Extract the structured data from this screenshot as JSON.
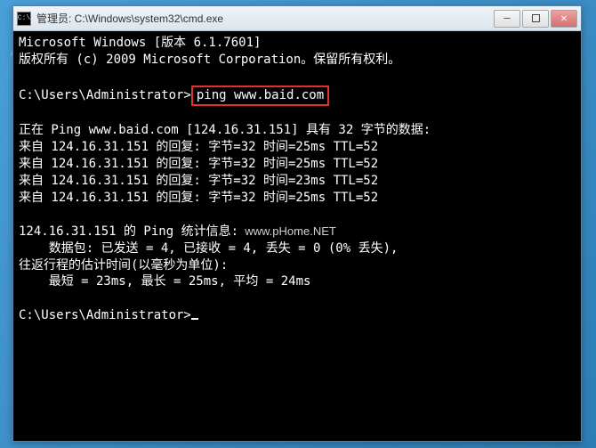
{
  "watermark_bg": "AJ 网",
  "titlebar": {
    "icon_text": "C:\\",
    "title": "管理员: C:\\Windows\\system32\\cmd.exe"
  },
  "console": {
    "line1": "Microsoft Windows [版本 6.1.7601]",
    "line2_a": "版权所有 (c) 2009 Microsoft Corporation。",
    "line2_b": "保留所有权利。",
    "prompt1_path": "C:\\Users\\Administrator>",
    "prompt1_cmd": "ping www.baid.com",
    "ping_header": "正在 Ping www.baid.com [124.16.31.151] 具有 32 字节的数据:",
    "reply1": "来自 124.16.31.151 的回复: 字节=32 时间=25ms TTL=52",
    "reply2": "来自 124.16.31.151 的回复: 字节=32 时间=25ms TTL=52",
    "reply3": "来自 124.16.31.151 的回复: 字节=32 时间=23ms TTL=52",
    "reply4": "来自 124.16.31.151 的回复: 字节=32 时间=25ms TTL=52",
    "stats_header_a": "124.16.31.151 的 Ping 统计信息:",
    "watermark_inline": "  www.pHome.NET",
    "stats_packets": "    数据包: 已发送 = 4, 已接收 = 4, 丢失 = 0 (0% 丢失),",
    "stats_rt_header": "往返行程的估计时间(以毫秒为单位):",
    "stats_rt_values": "    最短 = 23ms, 最长 = 25ms, 平均 = 24ms",
    "prompt2": "C:\\Users\\Administrator>"
  }
}
